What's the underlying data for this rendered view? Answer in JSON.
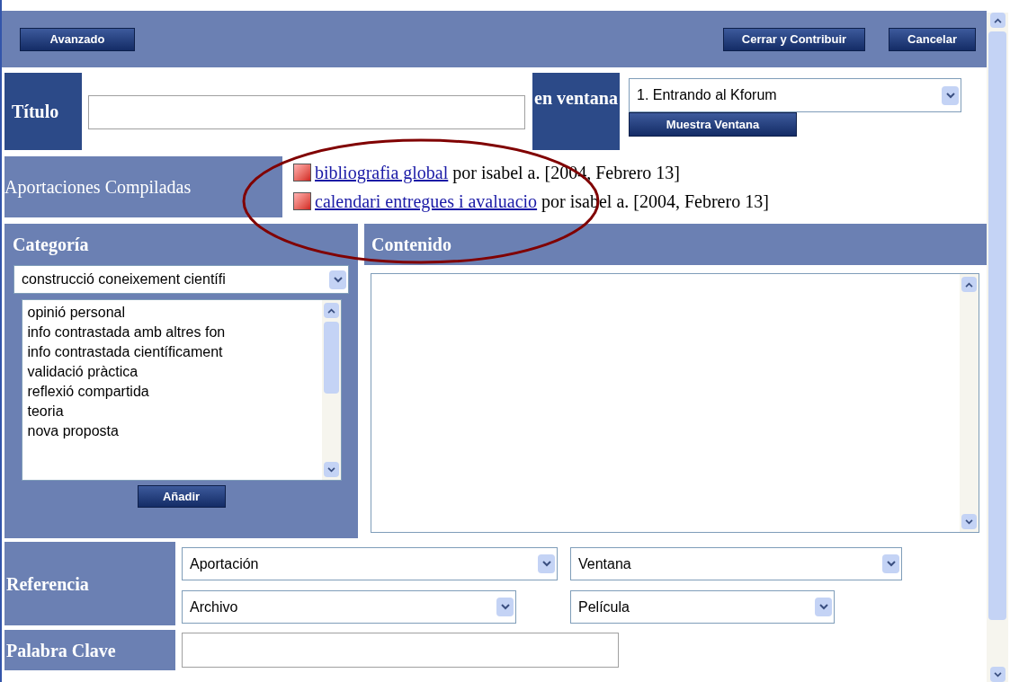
{
  "toolbar": {
    "left_button": "Avanzado",
    "right_buttons": [
      "Cerrar y Contribuir",
      "Cancelar"
    ]
  },
  "title_field": {
    "label": "Título"
  },
  "window_select": {
    "label": "en ventana",
    "value": "1. Entrando al Kforum",
    "button": "Muestra Ventana"
  },
  "compiled": {
    "label": "Aportaciones Compiladas",
    "items": [
      {
        "link": "bibliografia global",
        "meta": "por isabel a. [2004, Febrero 13]"
      },
      {
        "link": "calendari entregues i avaluacio",
        "meta": "por isabel a. [2004, Febrero 13]"
      }
    ]
  },
  "category": {
    "label": "Categoría",
    "value": "construcció coneixement científi",
    "options": [
      "opinió personal",
      "info contrastada amb altres fon",
      "info contrastada científicament",
      "validació pràctica",
      "reflexió compartida",
      "teoria",
      "nova proposta"
    ],
    "button": "Añadir"
  },
  "content": {
    "label": "Contenido"
  },
  "reference": {
    "label": "Referencia",
    "selects": [
      {
        "value": "Aportación"
      },
      {
        "value": "Ventana"
      },
      {
        "value": "Archivo"
      },
      {
        "value": "Película"
      }
    ]
  },
  "keyword": {
    "label": "Palabra Clave"
  }
}
